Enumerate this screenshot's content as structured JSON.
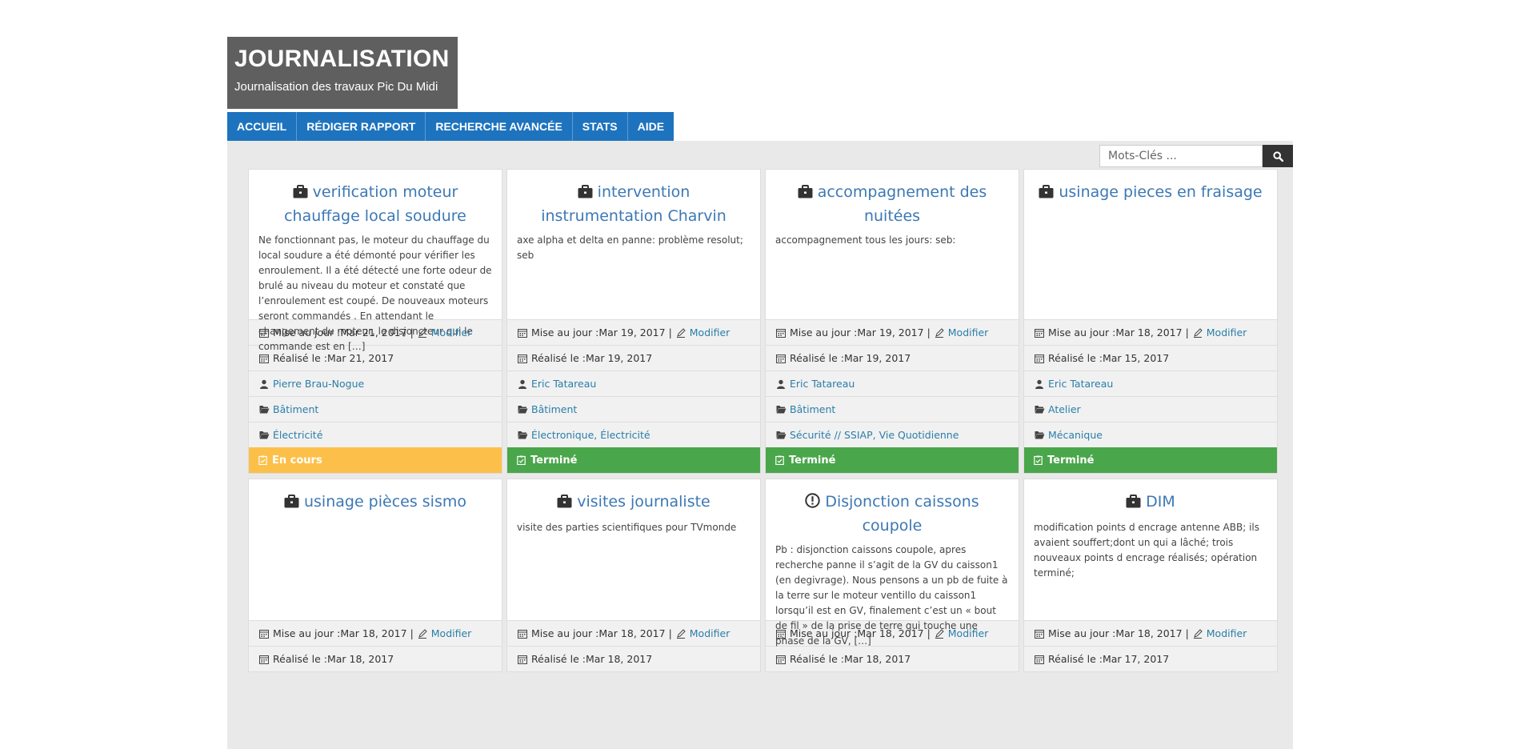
{
  "brand": {
    "title": "JOURNALISATION",
    "tagline": "Journalisation des travaux Pic Du Midi"
  },
  "nav": {
    "items": [
      "ACCUEIL",
      "RÉDIGER RAPPORT",
      "RECHERCHE AVANCÉE",
      "STATS",
      "AIDE"
    ]
  },
  "search": {
    "placeholder": "Mots-Clés ..."
  },
  "labels": {
    "updated": "Mise au jour : ",
    "edit": "Modifier",
    "done_on": "Réalisé le : "
  },
  "colors": {
    "primary": "#1e73be",
    "link": "#2a7ea8",
    "status_in_progress": "#fcc04a",
    "status_done": "#4aa64a"
  },
  "cards": [
    {
      "icon": "briefcase-icon",
      "title": "verification moteur chauffage local soudure",
      "excerpt": "Ne fonctionnant pas, le moteur du chauffage du local soudure a été démonté pour vérifier les enroulement. Il a été détecté une forte odeur de brulé au niveau du moteur et constaté que l’enroulement est coupé. De nouveaux moteurs seront commandés . En attendant le changement du moteur, le disjoncteur qui le commande est en […]",
      "updated": "Mar 21, 2017",
      "done": "Mar 21, 2017",
      "author": "Pierre Brau-Nogue",
      "location": "Bâtiment",
      "category": "Électricité",
      "status": "En cours"
    },
    {
      "icon": "briefcase-icon",
      "title": "intervention instrumentation Charvin",
      "excerpt": "axe alpha et delta en panne: problème resolut; seb",
      "updated": "Mar 19, 2017",
      "done": "Mar 19, 2017",
      "author": "Eric Tatareau",
      "location": "Bâtiment",
      "category": "Électronique, Électricité",
      "status": "Terminé"
    },
    {
      "icon": "briefcase-icon",
      "title": "accompagnement des nuitées",
      "excerpt": "accompagnement tous les jours: seb:",
      "updated": "Mar 19, 2017",
      "done": "Mar 19, 2017",
      "author": "Eric Tatareau",
      "location": "Bâtiment",
      "category": "Sécurité // SSIAP, Vie Quotidienne",
      "status": "Terminé"
    },
    {
      "icon": "briefcase-icon",
      "title": "usinage pieces en fraisage",
      "excerpt": "",
      "updated": "Mar 18, 2017",
      "done": "Mar 15, 2017",
      "author": "Eric Tatareau",
      "location": "Atelier",
      "category": "Mécanique",
      "status": "Terminé"
    },
    {
      "icon": "briefcase-icon",
      "title": "usinage pièces sismo",
      "excerpt": "",
      "updated": "Mar 18, 2017",
      "done": "Mar 18, 2017"
    },
    {
      "icon": "briefcase-icon",
      "title": "visites journaliste",
      "excerpt": "visite des parties scientifiques pour TVmonde",
      "updated": "Mar 18, 2017",
      "done": "Mar 18, 2017"
    },
    {
      "icon": "alert-icon",
      "title": "Disjonction caissons coupole",
      "excerpt": "Pb : disjonction caissons coupole, apres recherche panne il s’agit de la GV du caisson1 (en degivrage). Nous pensons a un pb de fuite à la terre sur le moteur ventillo du caisson1 lorsqu’il est en GV, finalement c’est un « bout de fil » de la prise de terre qui touche une phase de la GV, […]",
      "updated": "Mar 18, 2017",
      "done": "Mar 18, 2017"
    },
    {
      "icon": "briefcase-icon",
      "title": "DIM",
      "excerpt": "modification points d encrage antenne ABB; ils avaient souffert;dont un qui a lâché; trois nouveaux points d encrage réalisés; opération terminé;",
      "updated": "Mar 18, 2017",
      "done": "Mar 17, 2017"
    }
  ]
}
